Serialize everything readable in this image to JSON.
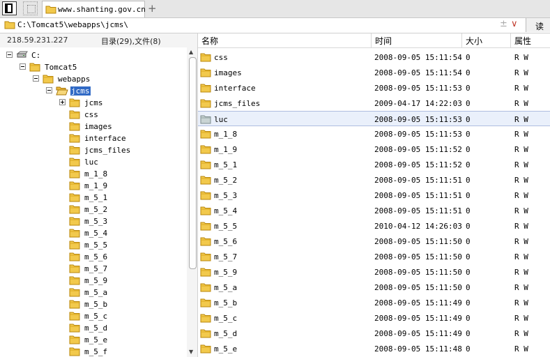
{
  "tab": {
    "title": "www.shanting.gov.cn"
  },
  "address": {
    "path": "C:\\Tomcat5\\webapps\\jcms\\",
    "read_label": "读取"
  },
  "info": {
    "ip": "218.59.231.227",
    "counts": "目录(29),文件(8)"
  },
  "tree": [
    {
      "label": "C:",
      "depth": 0,
      "expander": "minus",
      "icon": "drive"
    },
    {
      "label": "Tomcat5",
      "depth": 1,
      "expander": "minus",
      "icon": "folder"
    },
    {
      "label": "webapps",
      "depth": 2,
      "expander": "minus",
      "icon": "folder"
    },
    {
      "label": "jcms",
      "depth": 3,
      "expander": "minus",
      "icon": "folder-open",
      "selected": true
    },
    {
      "label": "jcms",
      "depth": 4,
      "expander": "plus",
      "icon": "folder"
    },
    {
      "label": "css",
      "depth": 4,
      "icon": "folder"
    },
    {
      "label": "images",
      "depth": 4,
      "icon": "folder"
    },
    {
      "label": "interface",
      "depth": 4,
      "icon": "folder"
    },
    {
      "label": "jcms_files",
      "depth": 4,
      "icon": "folder"
    },
    {
      "label": "luc",
      "depth": 4,
      "icon": "folder"
    },
    {
      "label": "m_1_8",
      "depth": 4,
      "icon": "folder"
    },
    {
      "label": "m_1_9",
      "depth": 4,
      "icon": "folder"
    },
    {
      "label": "m_5_1",
      "depth": 4,
      "icon": "folder"
    },
    {
      "label": "m_5_2",
      "depth": 4,
      "icon": "folder"
    },
    {
      "label": "m_5_3",
      "depth": 4,
      "icon": "folder"
    },
    {
      "label": "m_5_4",
      "depth": 4,
      "icon": "folder"
    },
    {
      "label": "m_5_5",
      "depth": 4,
      "icon": "folder"
    },
    {
      "label": "m_5_6",
      "depth": 4,
      "icon": "folder"
    },
    {
      "label": "m_5_7",
      "depth": 4,
      "icon": "folder"
    },
    {
      "label": "m_5_9",
      "depth": 4,
      "icon": "folder"
    },
    {
      "label": "m_5_a",
      "depth": 4,
      "icon": "folder"
    },
    {
      "label": "m_5_b",
      "depth": 4,
      "icon": "folder"
    },
    {
      "label": "m_5_c",
      "depth": 4,
      "icon": "folder"
    },
    {
      "label": "m_5_d",
      "depth": 4,
      "icon": "folder"
    },
    {
      "label": "m_5_e",
      "depth": 4,
      "icon": "folder"
    },
    {
      "label": "m_5_f",
      "depth": 4,
      "icon": "folder"
    }
  ],
  "columns": {
    "name": "名称",
    "time": "时间",
    "size": "大小",
    "attr": "属性"
  },
  "files": [
    {
      "name": "css",
      "time": "2008-09-05 15:11:54",
      "size": "0",
      "attr": "R W"
    },
    {
      "name": "images",
      "time": "2008-09-05 15:11:54",
      "size": "0",
      "attr": "R W"
    },
    {
      "name": "interface",
      "time": "2008-09-05 15:11:53",
      "size": "0",
      "attr": "R W"
    },
    {
      "name": "jcms_files",
      "time": "2009-04-17 14:22:03",
      "size": "0",
      "attr": "R W"
    },
    {
      "name": "luc",
      "time": "2008-09-05 15:11:53",
      "size": "0",
      "attr": "R W",
      "selected": true
    },
    {
      "name": "m_1_8",
      "time": "2008-09-05 15:11:53",
      "size": "0",
      "attr": "R W"
    },
    {
      "name": "m_1_9",
      "time": "2008-09-05 15:11:52",
      "size": "0",
      "attr": "R W"
    },
    {
      "name": "m_5_1",
      "time": "2008-09-05 15:11:52",
      "size": "0",
      "attr": "R W"
    },
    {
      "name": "m_5_2",
      "time": "2008-09-05 15:11:51",
      "size": "0",
      "attr": "R W"
    },
    {
      "name": "m_5_3",
      "time": "2008-09-05 15:11:51",
      "size": "0",
      "attr": "R W"
    },
    {
      "name": "m_5_4",
      "time": "2008-09-05 15:11:51",
      "size": "0",
      "attr": "R W"
    },
    {
      "name": "m_5_5",
      "time": "2010-04-12 14:26:03",
      "size": "0",
      "attr": "R W"
    },
    {
      "name": "m_5_6",
      "time": "2008-09-05 15:11:50",
      "size": "0",
      "attr": "R W"
    },
    {
      "name": "m_5_7",
      "time": "2008-09-05 15:11:50",
      "size": "0",
      "attr": "R W"
    },
    {
      "name": "m_5_9",
      "time": "2008-09-05 15:11:50",
      "size": "0",
      "attr": "R W"
    },
    {
      "name": "m_5_a",
      "time": "2008-09-05 15:11:50",
      "size": "0",
      "attr": "R W"
    },
    {
      "name": "m_5_b",
      "time": "2008-09-05 15:11:49",
      "size": "0",
      "attr": "R W"
    },
    {
      "name": "m_5_c",
      "time": "2008-09-05 15:11:49",
      "size": "0",
      "attr": "R W"
    },
    {
      "name": "m_5_d",
      "time": "2008-09-05 15:11:49",
      "size": "0",
      "attr": "R W"
    },
    {
      "name": "m_5_e",
      "time": "2008-09-05 15:11:48",
      "size": "0",
      "attr": "R W"
    }
  ],
  "colors": {
    "selection": "#316ac5",
    "folder": "#f2c94c",
    "folder_edge": "#b8860b"
  }
}
